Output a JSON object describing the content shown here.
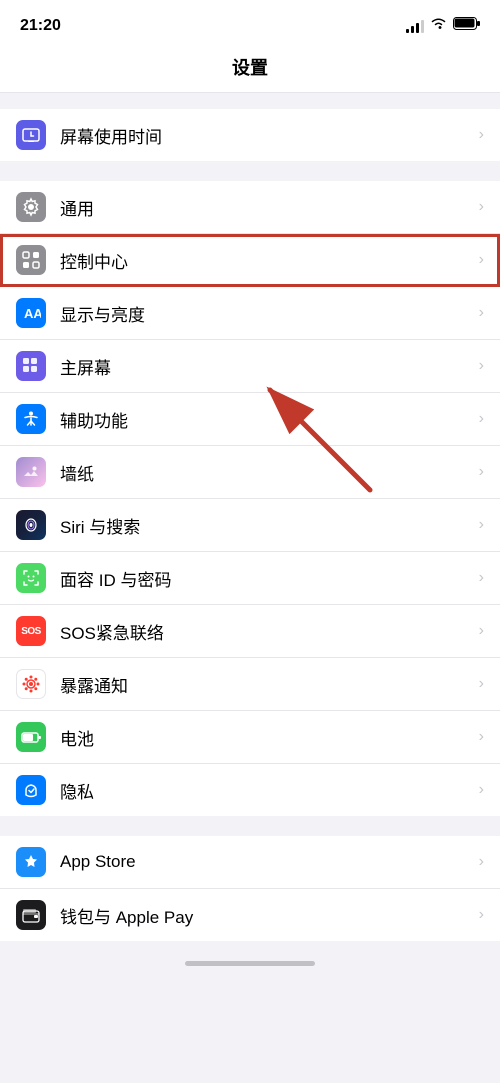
{
  "statusBar": {
    "time": "21:20"
  },
  "pageTitle": "设置",
  "sections": [
    {
      "id": "section1",
      "items": [
        {
          "id": "screen-time",
          "label": "屏幕使用时间",
          "iconBg": "icon-screentime",
          "iconType": "screentime"
        }
      ]
    },
    {
      "id": "section2",
      "items": [
        {
          "id": "general",
          "label": "通用",
          "iconBg": "icon-gray",
          "iconType": "gear"
        },
        {
          "id": "control-center",
          "label": "控制中心",
          "iconBg": "icon-gray",
          "iconType": "control",
          "highlighted": true
        },
        {
          "id": "display",
          "label": "显示与亮度",
          "iconBg": "icon-display",
          "iconType": "display"
        },
        {
          "id": "home-screen",
          "label": "主屏幕",
          "iconBg": "icon-home",
          "iconType": "home"
        },
        {
          "id": "accessibility",
          "label": "辅助功能",
          "iconBg": "icon-blue",
          "iconType": "accessibility"
        },
        {
          "id": "wallpaper",
          "label": "墙纸",
          "iconBg": "icon-pink",
          "iconType": "wallpaper"
        },
        {
          "id": "siri",
          "label": "Siri 与搜索",
          "iconBg": "icon-siri",
          "iconType": "siri"
        },
        {
          "id": "faceid",
          "label": "面容 ID 与密码",
          "iconBg": "icon-faceid",
          "iconType": "faceid"
        },
        {
          "id": "sos",
          "label": "SOS紧急联络",
          "iconBg": "icon-sos",
          "iconType": "sos"
        },
        {
          "id": "exposure",
          "label": "暴露通知",
          "iconBg": "icon-exposure",
          "iconType": "exposure"
        },
        {
          "id": "battery",
          "label": "电池",
          "iconBg": "icon-green",
          "iconType": "battery"
        },
        {
          "id": "privacy",
          "label": "隐私",
          "iconBg": "icon-blue",
          "iconType": "privacy"
        }
      ]
    },
    {
      "id": "section3",
      "items": [
        {
          "id": "appstore",
          "label": "App Store",
          "iconBg": "icon-appstore",
          "iconType": "appstore"
        },
        {
          "id": "wallet",
          "label": "钱包与 Apple Pay",
          "iconBg": "icon-wallet",
          "iconType": "wallet"
        }
      ]
    }
  ]
}
